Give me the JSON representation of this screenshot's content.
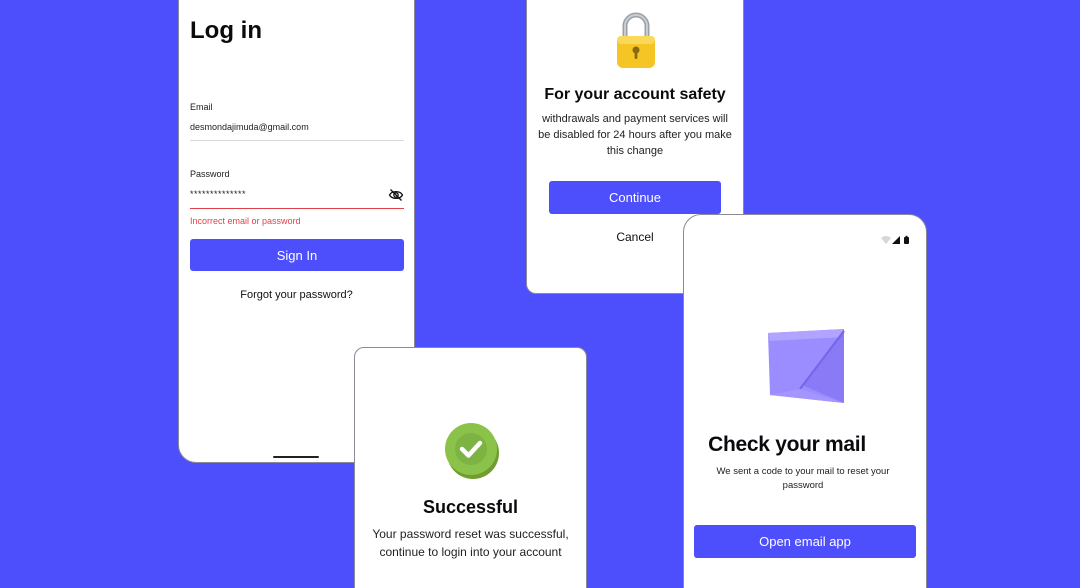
{
  "login": {
    "title": "Log in",
    "email_label": "Email",
    "email_value": "desmondajimuda@gmail.com",
    "password_label": "Password",
    "password_value": "**************",
    "error": "Incorrect email or password",
    "sign_in": "Sign In",
    "forgot": "Forgot your password?"
  },
  "safety": {
    "title": "For your account safety",
    "message": "withdrawals and payment services will be disabled for 24 hours after you make this change",
    "continue": "Continue",
    "cancel": "Cancel"
  },
  "success": {
    "title": "Successful",
    "message": "Your password reset was successful, continue to login into your account"
  },
  "mail": {
    "title": "Check your mail",
    "message": "We sent a code to your mail to reset your password",
    "open": "Open email app"
  },
  "icons": {
    "eye": "eye-off-icon",
    "lock": "padlock-icon",
    "check": "check-badge-icon",
    "envelope": "envelope-icon",
    "status": "status-bar-icons"
  },
  "colors": {
    "background": "#4c4ffb",
    "primary": "#4c4ffb",
    "error": "#e0424b",
    "success": "#8bc34a",
    "envelope": "#9b8cff"
  }
}
